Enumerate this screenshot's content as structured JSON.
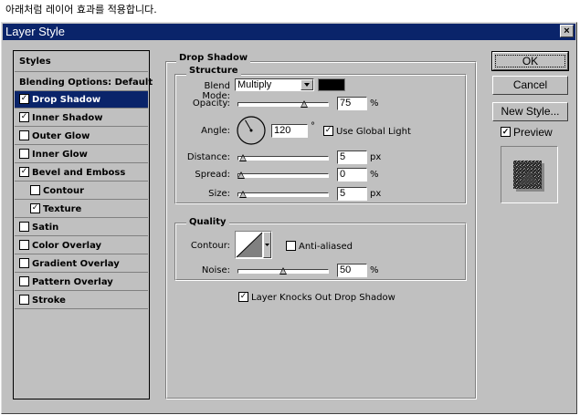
{
  "caption": "아래처럼 레이어 효과를 적용합니다.",
  "window": {
    "title": "Layer Style",
    "close_glyph": "×"
  },
  "left_panel": {
    "styles_header": "Styles",
    "blending_options": "Blending Options: Default",
    "items": [
      {
        "label": "Drop Shadow",
        "checked": true,
        "selected": true,
        "indent": false
      },
      {
        "label": "Inner Shadow",
        "checked": true,
        "selected": false,
        "indent": false
      },
      {
        "label": "Outer Glow",
        "checked": false,
        "selected": false,
        "indent": false
      },
      {
        "label": "Inner Glow",
        "checked": false,
        "selected": false,
        "indent": false
      },
      {
        "label": "Bevel and Emboss",
        "checked": true,
        "selected": false,
        "indent": false
      },
      {
        "label": "Contour",
        "checked": false,
        "selected": false,
        "indent": true
      },
      {
        "label": "Texture",
        "checked": true,
        "selected": false,
        "indent": true
      },
      {
        "label": "Satin",
        "checked": false,
        "selected": false,
        "indent": false
      },
      {
        "label": "Color Overlay",
        "checked": false,
        "selected": false,
        "indent": false
      },
      {
        "label": "Gradient Overlay",
        "checked": false,
        "selected": false,
        "indent": false
      },
      {
        "label": "Pattern Overlay",
        "checked": false,
        "selected": false,
        "indent": false
      },
      {
        "label": "Stroke",
        "checked": false,
        "selected": false,
        "indent": false
      }
    ]
  },
  "drop_shadow": {
    "title": "Drop Shadow",
    "structure": {
      "title": "Structure",
      "blend_mode": {
        "label": "Blend Mode:",
        "value": "Multiply",
        "color": "#000000"
      },
      "opacity": {
        "label": "Opacity:",
        "value": "75",
        "unit": "%",
        "level": 0.75
      },
      "angle": {
        "label": "Angle:",
        "value": "120",
        "unit": "°",
        "degrees": 120,
        "use_global_light": {
          "label": "Use Global Light",
          "checked": true
        }
      },
      "distance": {
        "label": "Distance:",
        "value": "5",
        "unit": "px",
        "level": 0.02
      },
      "spread": {
        "label": "Spread:",
        "value": "0",
        "unit": "%",
        "level": 0.0
      },
      "size": {
        "label": "Size:",
        "value": "5",
        "unit": "px",
        "level": 0.02
      }
    },
    "quality": {
      "title": "Quality",
      "contour": {
        "label": "Contour:",
        "anti_aliased": {
          "label": "Anti-aliased",
          "checked": false
        }
      },
      "noise": {
        "label": "Noise:",
        "value": "50",
        "unit": "%",
        "level": 0.5
      }
    },
    "knockout": {
      "label": "Layer Knocks Out Drop Shadow",
      "checked": true
    }
  },
  "buttons": {
    "ok": "OK",
    "cancel": "Cancel",
    "new_style": "New Style...",
    "preview": "Preview",
    "preview_checked": true
  }
}
